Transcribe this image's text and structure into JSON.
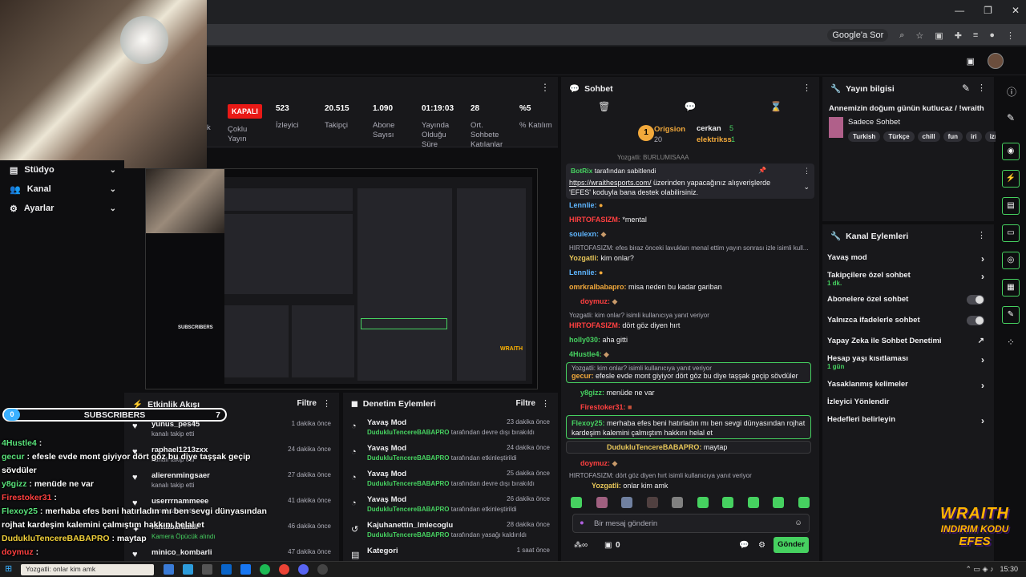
{
  "browser": {
    "google_chip": "Google'a Sor"
  },
  "stats": {
    "status": "KAPALI",
    "status_label": "Çoklu Yayın",
    "viewers": "523",
    "viewers_label": "İzleyici",
    "followers": "20.515",
    "followers_label": "Takipçi",
    "subs": "1.090",
    "subs_label": "Abone Sayısı",
    "uptime": "01:19:03",
    "uptime_label": "Yayında Olduğu Süre",
    "avg_chatters": "28",
    "avg_chatters_label": "Ort. Sohbete Katılanlar",
    "engagement": "%5",
    "engagement_label": "% Katılım",
    "partial_letter": "k"
  },
  "nav": {
    "item0": "Stüdyo",
    "item1": "Kanal",
    "item2": "Ayarlar"
  },
  "preview": {
    "wraith": "WRAITH",
    "subscribers": "SUBSCRIBERS"
  },
  "overlay": {
    "subs_count": "0",
    "subs_label": "SUBSCRIBERS",
    "subs_goal": "7",
    "lines": [
      {
        "name": "4Hustle4",
        "text": " :"
      },
      {
        "name": "gecur",
        "text": " : efesle evde mont giyiyor dört göz bu diye taşşak geçip"
      },
      {
        "name": "",
        "text": "sövdüler"
      },
      {
        "name": "y8gizz",
        "text": " : menüde ne var"
      },
      {
        "name": "Firestoker31",
        "text": " :"
      },
      {
        "name": "Flexoy25",
        "text": " : merhaba efes beni hatırladın mı ben sevgi dünyasından"
      },
      {
        "name": "",
        "text": "rojhat kardeşim kalemini çalmıştım hakkını helal et"
      },
      {
        "name": "DudukluTencereBABAPRO",
        "text": " : maytap"
      },
      {
        "name": "doymuz",
        "text": " :"
      }
    ]
  },
  "activity": {
    "title": "Etkinlik Akışı",
    "filter": "Filtre",
    "items": [
      {
        "name": "yunus_pes45",
        "sub": "kanalı takip etti",
        "time": "1 dakika önce"
      },
      {
        "name": "raphael1213zxx",
        "sub": "kanalı takip etti",
        "time": "24 dakika önce"
      },
      {
        "name": "alierenmingsaer",
        "sub": "kanalı takip etti",
        "time": "27 dakika önce"
      },
      {
        "name": "userrrnammeee",
        "sub": "kanalı takip etti",
        "time": "41 dakika önce"
      },
      {
        "name": "hattabafaaali",
        "sub": "Kamera Öpücük alındı",
        "time": "46 dakika önce"
      },
      {
        "name": "minico_kombarli",
        "sub": "",
        "time": "47 dakika önce"
      }
    ]
  },
  "moderation": {
    "title": "Denetim Eylemleri",
    "filter": "Filtre",
    "items": [
      {
        "name": "Yavaş Mod",
        "user": "DudukluTencereBABAPRO",
        "sub": " tarafından devre dışı bırakıldı",
        "time": "23 dakika önce"
      },
      {
        "name": "Yavaş Mod",
        "user": "DudukluTencereBABAPRO",
        "sub": " tarafından etkinleştirildi",
        "time": "24 dakika önce"
      },
      {
        "name": "Yavaş Mod",
        "user": "DudukluTencereBABAPRO",
        "sub": " tarafından devre dışı bırakıldı",
        "time": "25 dakika önce"
      },
      {
        "name": "Yavaş Mod",
        "user": "DudukluTencereBABAPRO",
        "sub": " tarafından etkinleştirildi",
        "time": "26 dakika önce"
      },
      {
        "name": "Kajuhanettin_lmlecoglu",
        "user": "DudukluTencereBABAPRO",
        "sub": " tarafından yasağı kaldırıldı",
        "time": "28 dakika önce"
      },
      {
        "name": "Kategori",
        "user": "",
        "sub": "",
        "time": "1 saat önce"
      }
    ]
  },
  "chat": {
    "title": "Sohbet",
    "top1_name": "Origsion",
    "top1_count": "20",
    "top2_name": "cerkan",
    "top2_count": "5",
    "top3_name": "elektrikss",
    "top3_count": "1",
    "cut_line": "Yozgatli: BURLUMISAAA",
    "pinned_by": "BotRix",
    "pinned_suffix": " tarafından sabitlendi",
    "pinned_link": "https://wraithesports.com/",
    "pinned_text": " üzerinden yapacağınız alışverişlerde 'EFES' koduyla bana destek olabilirsiniz.",
    "m1_name": "Lennlie:",
    "m2_name": "HIRTOFASIZM:",
    "m2_text": " *mental",
    "m3_name": "soulexn:",
    "m4_hint": "HIRTOFASIZM: efes biraz önceki lavukları menal ettim yayın sonrası izle isimli kull...",
    "m4_name": "Yozgatli:",
    "m4_text": " kim onlar?",
    "m5_name": "Lennlie:",
    "m6_name": "omrkralbabapro:",
    "m6_text": " misa neden bu kadar gariban",
    "m7_name": "doymuz:",
    "m8_hint": "Yozgatli: kim onlar? isimli kullanıcıya yanıt veriyor",
    "m8_name": "HIRTOFASIZM:",
    "m8_text": " dört göz diyen hırt",
    "m9_name": "holly030:",
    "m9_text": " aha gitti",
    "m10_name": "4Hustle4:",
    "m11_hint": "Yozgatli: kim onlar? isimli kullanıcıya yanıt veriyor",
    "m11_name": "gecur:",
    "m11_text": " efesle evde mont giyiyor dört göz bu diye taşşak geçip sövdüler",
    "m12_name": "y8gizz:",
    "m12_text": " menüde ne var",
    "m13_name": "Firestoker31:",
    "m14_name": "Flexoy25:",
    "m14_text": " merhaba efes beni hatırladın mı ben sevgi dünyasından rojhat kardeşim kalemini çalmıştım hakkını helal et",
    "m15_name": "DudukluTencereBABAPRO:",
    "m15_text": " maytap",
    "m16_name": "doymuz:",
    "m17_hint": "HIRTOFASIZM: dört göz diyen hırt isimli kullanıcıya yanıt veriyor",
    "m17_name": "Yozgatli:",
    "m17_text": " onlar kim amk",
    "input_placeholder": "Bir mesaj gönderin",
    "points": "0",
    "send": "Gönder"
  },
  "info": {
    "title": "Yayın bilgisi",
    "stream_title": "Annemizin doğum günün kutlucaz / !wraith",
    "category": "Sadece Sohbet",
    "tags": [
      "Turkish",
      "Türkçe",
      "chill",
      "fun",
      "iri",
      "izm"
    ]
  },
  "channel_actions": {
    "title": "Kanal Eylemleri",
    "slow": "Yavaş mod",
    "followers_only": "Takipçilere özel sohbet",
    "followers_only_sub": "1 dk.",
    "subs_only": "Abonelere özel sohbet",
    "emote_only": "Yalnızca ifadelerle sohbet",
    "ai": "Yapay Zeka ile Sohbet Denetimi",
    "account_age": "Hesap yaşı kısıtlaması",
    "account_age_sub": "1 gün",
    "banned_words": "Yasaklanmış kelimeler",
    "raid": "İzleyici Yönlendir",
    "goals": "Hedefleri belirleyin"
  },
  "logo": {
    "l1": "WRAITH",
    "l2": "INDIRIM KODU",
    "l3": "EFES"
  },
  "taskbar": {
    "search": "Yozgatli: onlar kim amk",
    "time": "15:30"
  }
}
